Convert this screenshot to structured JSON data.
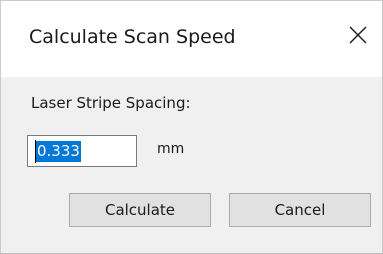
{
  "dialog": {
    "title": "Calculate Scan Speed",
    "close_icon": "close-icon"
  },
  "form": {
    "spacing_label": "Laser Stripe Spacing:",
    "spacing_value": "0.333",
    "spacing_unit": "mm"
  },
  "buttons": {
    "calculate": "Calculate",
    "cancel": "Cancel"
  },
  "colors": {
    "selection_bg": "#0078d7",
    "client_bg": "#f0f0f0",
    "button_bg": "#e1e1e1"
  }
}
